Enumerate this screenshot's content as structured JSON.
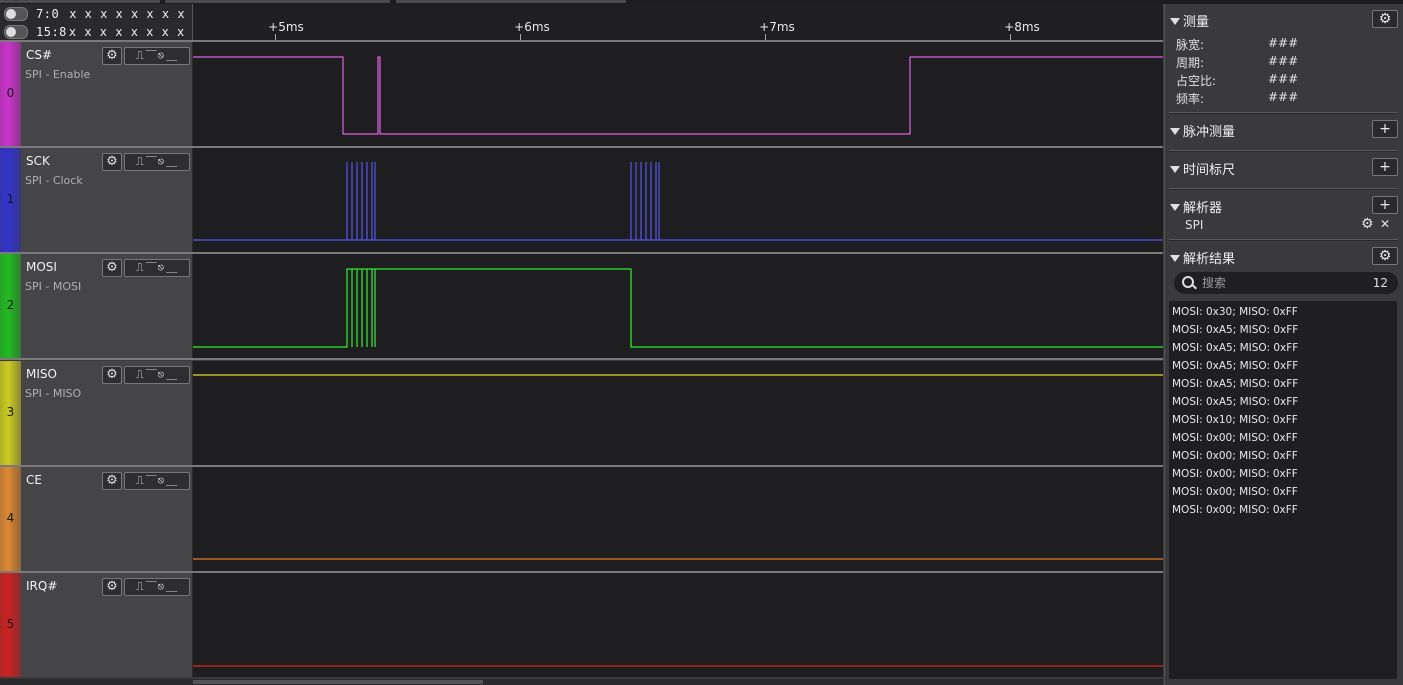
{
  "header": {
    "bit_rows": [
      {
        "label": "7:0",
        "values": "x x x x x x x x"
      },
      {
        "label": "15:8",
        "values": "x x x x x x x x"
      }
    ],
    "ruler_labels": [
      "+5ms",
      "+6ms",
      "+7ms",
      "+8ms"
    ]
  },
  "channels": [
    {
      "index": "0",
      "name": "CS#",
      "subtitle": "SPI - Enable",
      "color": "#cc33cc",
      "wave_color": "#e060e0"
    },
    {
      "index": "1",
      "name": "SCK",
      "subtitle": "SPI - Clock",
      "color": "#3333cc",
      "wave_color": "#5555ee"
    },
    {
      "index": "2",
      "name": "MOSI",
      "subtitle": "SPI - MOSI",
      "color": "#22bb22",
      "wave_color": "#33ee33"
    },
    {
      "index": "3",
      "name": "MISO",
      "subtitle": "SPI - MISO",
      "color": "#cccc22",
      "wave_color": "#dddd33"
    },
    {
      "index": "4",
      "name": "CE",
      "subtitle": "",
      "color": "#dd8833",
      "wave_color": "#e07a20"
    },
    {
      "index": "5",
      "name": "IRQ#",
      "subtitle": "",
      "color": "#cc2222",
      "wave_color": "#dd2222"
    }
  ],
  "channel_buttons": {
    "gear": "⚙",
    "trigger": "⎍⎺⎋⎽"
  },
  "panel": {
    "measure": {
      "title": "测量",
      "rows": [
        {
          "label": "脉宽:",
          "value": "###"
        },
        {
          "label": "周期:",
          "value": "###"
        },
        {
          "label": "占空比:",
          "value": "###"
        },
        {
          "label": "频率:",
          "value": "###"
        }
      ]
    },
    "pulse_title": "脉冲测量",
    "timing_title": "时间标尺",
    "analyzers": {
      "title": "解析器",
      "items": [
        "SPI"
      ]
    },
    "results": {
      "title": "解析结果",
      "search_placeholder": "搜索",
      "count": "12",
      "items": [
        "MOSI: 0x30;  MISO: 0xFF",
        "MOSI: 0xA5;  MISO: 0xFF",
        "MOSI: 0xA5;  MISO: 0xFF",
        "MOSI: 0xA5;  MISO: 0xFF",
        "MOSI: 0xA5;  MISO: 0xFF",
        "MOSI: 0xA5;  MISO: 0xFF",
        "MOSI: 0x10;  MISO: 0xFF",
        "MOSI: 0x00;  MISO: 0xFF",
        "MOSI: 0x00;  MISO: 0xFF",
        "MOSI: 0x00;  MISO: 0xFF",
        "MOSI: 0x00;  MISO: 0xFF",
        "MOSI: 0x00;  MISO: 0xFF"
      ]
    },
    "icons": {
      "plus": "+",
      "gear": "⚙",
      "close": "✕"
    }
  }
}
